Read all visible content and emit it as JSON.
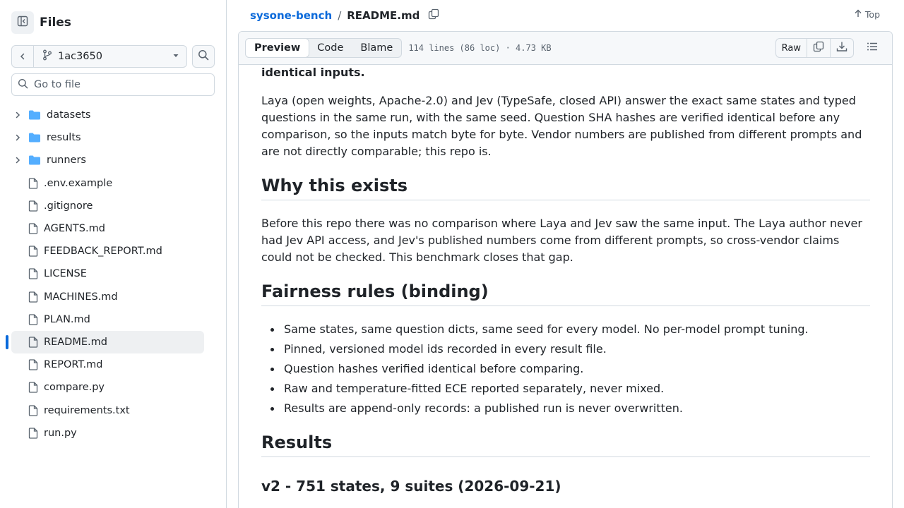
{
  "sidebar": {
    "title": "Files",
    "branch": "1ac3650",
    "goto_placeholder": "Go to file",
    "tree": [
      {
        "label": "datasets",
        "type": "folder"
      },
      {
        "label": "results",
        "type": "folder"
      },
      {
        "label": "runners",
        "type": "folder"
      },
      {
        "label": ".env.example",
        "type": "file"
      },
      {
        "label": ".gitignore",
        "type": "file"
      },
      {
        "label": "AGENTS.md",
        "type": "file"
      },
      {
        "label": "FEEDBACK_REPORT.md",
        "type": "file"
      },
      {
        "label": "LICENSE",
        "type": "file"
      },
      {
        "label": "MACHINES.md",
        "type": "file"
      },
      {
        "label": "PLAN.md",
        "type": "file"
      },
      {
        "label": "README.md",
        "type": "file",
        "active": true
      },
      {
        "label": "REPORT.md",
        "type": "file"
      },
      {
        "label": "compare.py",
        "type": "file"
      },
      {
        "label": "requirements.txt",
        "type": "file"
      },
      {
        "label": "run.py",
        "type": "file"
      }
    ]
  },
  "header": {
    "repo": "sysone-bench",
    "separator": "/",
    "file": "README.md",
    "top_label": "Top"
  },
  "file_header": {
    "tabs": [
      "Preview",
      "Code",
      "Blame"
    ],
    "selected_tab": "Preview",
    "meta": "114 lines (86 loc) · 4.73 KB",
    "raw_label": "Raw"
  },
  "readme": {
    "tail_text": "identical inputs.",
    "p1": "Laya (open weights, Apache-2.0) and Jev (TypeSafe, closed API) answer the exact same states and typed questions in the same run, with the same seed. Question SHA hashes are verified identical before any comparison, so the inputs match byte for byte. Vendor numbers are published from different prompts and are not directly comparable; this repo is.",
    "h_why": "Why this exists",
    "p2": "Before this repo there was no comparison where Laya and Jev saw the same input. The Laya author never had Jev API access, and Jev's published numbers come from different prompts, so cross-vendor claims could not be checked. This benchmark closes that gap.",
    "h_fair": "Fairness rules (binding)",
    "rules": [
      "Same states, same question dicts, same seed for every model. No per-model prompt tuning.",
      "Pinned, versioned model ids recorded in every result file.",
      "Question hashes verified identical before comparing.",
      "Raw and temperature-fitted ECE reported separately, never mixed.",
      "Results are append-only records: a published run is never overwritten."
    ],
    "h_results": "Results",
    "h_v2": "v2 - 751 states, 9 suites (2026-09-21)"
  },
  "colors": {
    "link": "#0969da",
    "folder": "#54aeff",
    "border": "#d1d9e0",
    "text": "#1f2328",
    "muted": "#59636e"
  }
}
